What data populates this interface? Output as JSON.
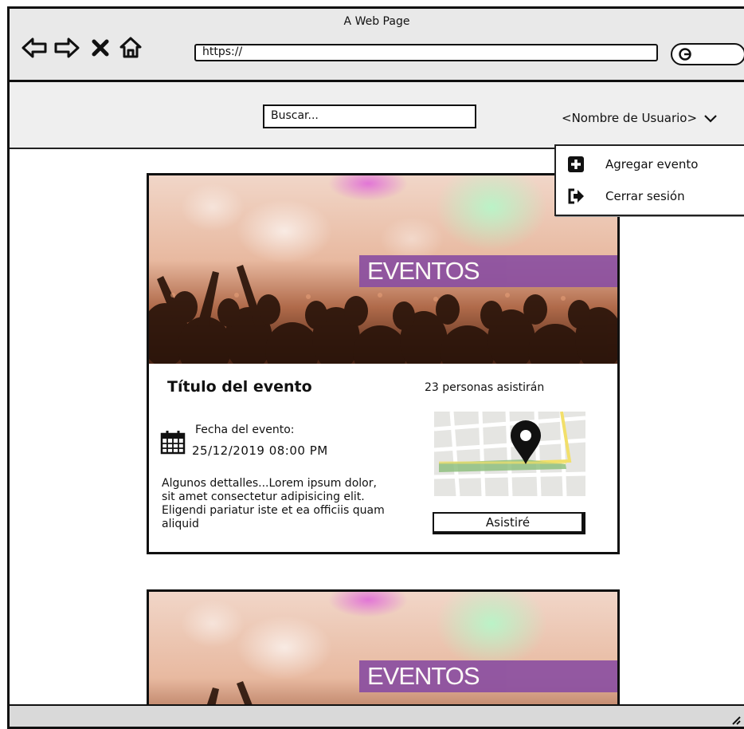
{
  "window": {
    "title": "A Web Page"
  },
  "toolbar": {
    "back_icon": "back-arrow-icon",
    "forward_icon": "forward-arrow-icon",
    "stop_icon": "close-icon",
    "home_icon": "home-icon",
    "url": "https://",
    "search_icon": "search-icon"
  },
  "header": {
    "search_placeholder": "Buscar...",
    "username": "<Nombre de Usuario>"
  },
  "user_menu": {
    "items": [
      {
        "label": "Agregar evento",
        "icon": "plus-square-icon"
      },
      {
        "label": "Cerrar sesión",
        "icon": "logout-icon"
      }
    ]
  },
  "events": [
    {
      "banner": "EVENTOS",
      "title": "Título del evento",
      "attendees": "23 personas asistirán",
      "date_label": "Fecha del evento:",
      "date_value": "25/12/2019 08:00 PM",
      "description": "Algunos dettalles...Lorem ipsum dolor, sit amet consectetur adipisicing elit. Eligendi pariatur iste et ea officiis quam aliquid",
      "attend_button": "Asistiré"
    },
    {
      "banner": "EVENTOS"
    }
  ],
  "colors": {
    "banner": "#8b4fa1",
    "chrome": "#e9e9e9",
    "map_route": "#8fbf7f",
    "map_road": "#f2df6a"
  }
}
